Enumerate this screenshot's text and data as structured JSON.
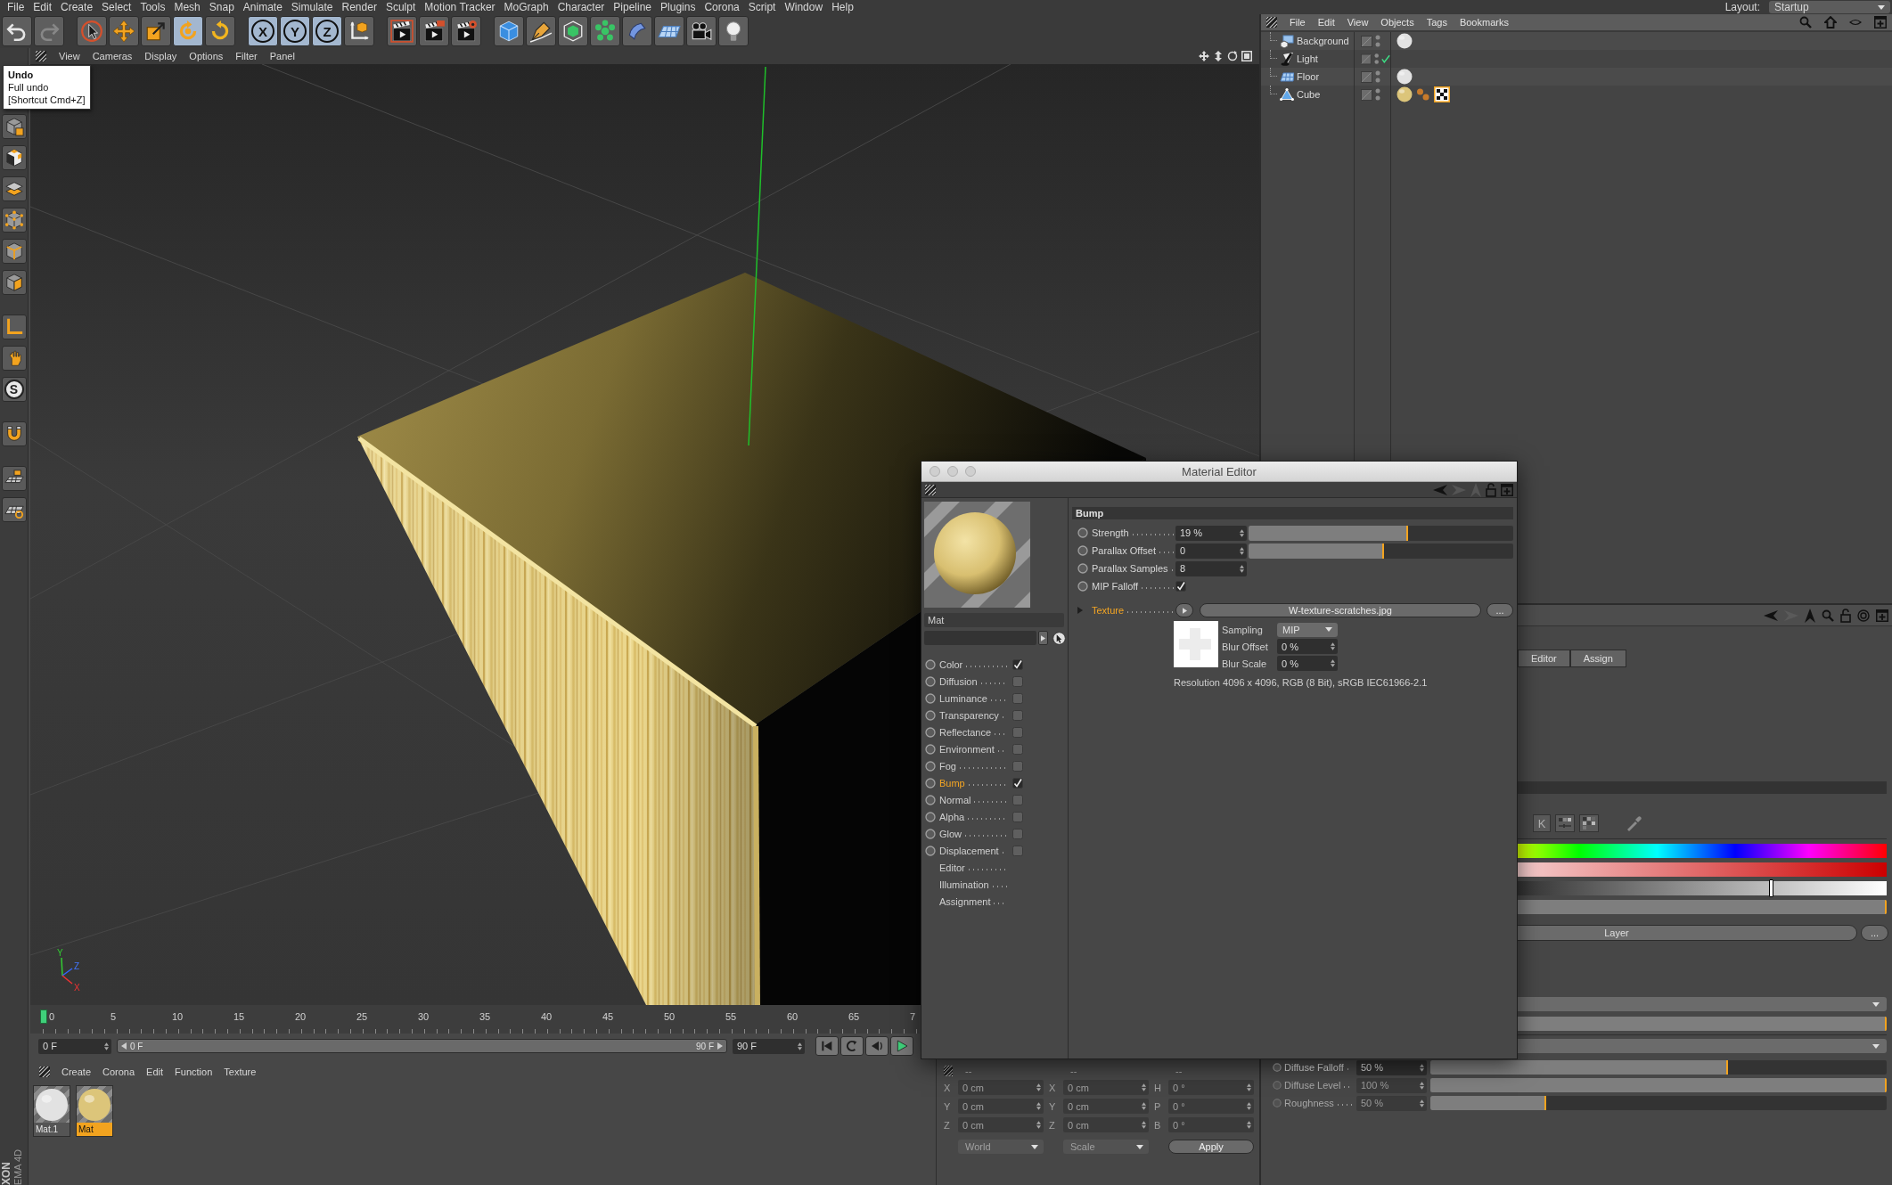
{
  "menubar": {
    "items": [
      "File",
      "Edit",
      "Create",
      "Select",
      "Tools",
      "Mesh",
      "Snap",
      "Animate",
      "Simulate",
      "Render",
      "Sculpt",
      "Motion Tracker",
      "MoGraph",
      "Character",
      "Pipeline",
      "Plugins",
      "Corona",
      "Script",
      "Window",
      "Help"
    ],
    "layout_label": "Layout:",
    "layout_value": "Startup"
  },
  "toolbar": {
    "tools": [
      {
        "on": false,
        "disabled": false
      },
      {
        "on": false,
        "disabled": true
      },
      {
        "on": false,
        "disabled": false
      },
      {
        "on": false,
        "disabled": false
      },
      {
        "on": false,
        "disabled": false
      },
      {
        "on": true,
        "disabled": false
      },
      {
        "on": false,
        "disabled": false
      },
      {
        "label": "X",
        "on": true,
        "disabled": false
      },
      {
        "label": "Y",
        "on": true,
        "disabled": false
      },
      {
        "label": "Z",
        "on": true,
        "disabled": false
      },
      {
        "on": false,
        "disabled": false
      },
      {
        "on": false,
        "disabled": false
      },
      {
        "on": false,
        "disabled": false
      },
      {
        "on": false,
        "disabled": false
      },
      {
        "on": false,
        "disabled": false
      },
      {
        "on": false,
        "disabled": false
      },
      {
        "on": false,
        "disabled": false
      },
      {
        "on": false,
        "disabled": false
      },
      {
        "on": false,
        "disabled": false
      },
      {
        "on": false,
        "disabled": false
      },
      {
        "on": false,
        "disabled": false
      },
      {
        "on": false,
        "disabled": false
      }
    ]
  },
  "tooltip": {
    "title": "Undo",
    "lines": [
      "Full undo",
      "[Shortcut Cmd+Z]"
    ]
  },
  "tool_palette": {
    "snap_label": "S"
  },
  "logo": {
    "lines": [
      "XON",
      "EMA 4D"
    ]
  },
  "viewport": {
    "menu": [
      "View",
      "Cameras",
      "Display",
      "Options",
      "Filter",
      "Panel"
    ],
    "axis_labels": [
      "Y",
      "Z",
      "X"
    ]
  },
  "timeline": {
    "ticks": [
      "0",
      "5",
      "10",
      "15",
      "20",
      "25",
      "30",
      "35",
      "40",
      "45",
      "50",
      "55",
      "60",
      "65",
      "7"
    ],
    "playhead": {
      "level": 0
    },
    "start_field": "0 F",
    "range_start": "0 F",
    "range_end": "90 F",
    "end_field": "90 F"
  },
  "material_manager": {
    "menu": [
      "Create",
      "Corona",
      "Edit",
      "Function",
      "Texture"
    ],
    "materials": [
      {
        "name": "Mat.1",
        "color": "#e2e2e2",
        "selected": false
      },
      {
        "name": "Mat",
        "color": "#dcc57a",
        "selected": true
      }
    ]
  },
  "coordinates": {
    "disabled": true,
    "headers": [
      "--",
      "--",
      "--"
    ],
    "rows": [
      [
        {
          "axis": "X",
          "value": "0 cm"
        },
        {
          "axis": "X",
          "value": "0 cm"
        },
        {
          "axis": "H",
          "value": "0 °"
        }
      ],
      [
        {
          "axis": "Y",
          "value": "0 cm"
        },
        {
          "axis": "Y",
          "value": "0 cm"
        },
        {
          "axis": "P",
          "value": "0 °"
        }
      ],
      [
        {
          "axis": "Z",
          "value": "0 cm"
        },
        {
          "axis": "Z",
          "value": "0 cm"
        },
        {
          "axis": "B",
          "value": "0 °"
        }
      ]
    ],
    "dropdowns": [
      "World",
      "Scale"
    ],
    "apply": "Apply"
  },
  "object_manager": {
    "menu": [
      "File",
      "Edit",
      "View",
      "Objects",
      "Tags",
      "Bookmarks"
    ],
    "objects": [
      {
        "name": "Background",
        "kind": "background",
        "enabled": false,
        "tags": [
          {
            "kind": "material",
            "color": "#e2e2e2",
            "selected": false
          }
        ]
      },
      {
        "name": "Light",
        "kind": "light",
        "enabled": true
      },
      {
        "name": "Floor",
        "kind": "floor",
        "enabled": false,
        "tags": [
          {
            "kind": "material",
            "color": "#e2e2e2",
            "selected": false
          }
        ]
      },
      {
        "name": "Cube",
        "kind": "polygon",
        "enabled": false,
        "tags": [
          {
            "kind": "material",
            "color": "#dcc57a",
            "selected": false
          },
          {
            "kind": "phong",
            "selected": false
          },
          {
            "kind": "uvw",
            "selected": true
          }
        ]
      }
    ]
  },
  "attribute_manager": {
    "tabs": [
      {
        "label": "Editor",
        "selected": false
      },
      {
        "label": "Assign",
        "selected": false
      }
    ],
    "kelvin_label": "K",
    "brightness": {
      "level": 0.75
    },
    "color_slider": {
      "level": 1
    },
    "layer_button": "Layer",
    "browse_button": "...",
    "controls": [
      {
        "kind": "dropdown"
      },
      {
        "kind": "slider",
        "level": 1
      },
      {
        "kind": "dropdown"
      }
    ],
    "params": [
      {
        "label": "Diffuse Falloff",
        "value": "50 %",
        "level": 0.65,
        "disabled": false
      },
      {
        "label": "Diffuse Level",
        "value": "100 %",
        "level": 1,
        "disabled": true
      },
      {
        "label": "Roughness",
        "value": "50 %",
        "level": 0.25,
        "disabled": true
      }
    ]
  },
  "material_editor": {
    "title": "Material Editor",
    "name": "Mat",
    "channels": [
      {
        "label": "Color",
        "checked": true,
        "selected": false
      },
      {
        "label": "Diffusion",
        "checked": false,
        "selected": false
      },
      {
        "label": "Luminance",
        "checked": false,
        "selected": false
      },
      {
        "label": "Transparency",
        "checked": false,
        "selected": false
      },
      {
        "label": "Reflectance",
        "checked": false,
        "selected": false
      },
      {
        "label": "Environment",
        "checked": false,
        "selected": false
      },
      {
        "label": "Fog",
        "checked": false,
        "selected": false
      },
      {
        "label": "Bump",
        "checked": true,
        "selected": true
      },
      {
        "label": "Normal",
        "checked": false,
        "selected": false
      },
      {
        "label": "Alpha",
        "checked": false,
        "selected": false
      },
      {
        "label": "Glow",
        "checked": false,
        "selected": false
      },
      {
        "label": "Displacement",
        "checked": false,
        "selected": false
      }
    ],
    "pages": [
      {
        "label": "Editor",
        "selected": false
      },
      {
        "label": "Illumination",
        "selected": false
      },
      {
        "label": "Assignment",
        "selected": false
      }
    ],
    "bump": {
      "title": "Bump",
      "params": [
        {
          "kind": "slider",
          "label": "Strength",
          "value": "19 %",
          "level": 0.6
        },
        {
          "kind": "slider",
          "label": "Parallax Offset",
          "value": "0",
          "level": 0.507
        },
        {
          "kind": "number",
          "label": "Parallax Samples",
          "value": "8"
        },
        {
          "kind": "checkbox",
          "label": "MIP Falloff",
          "checked": true
        }
      ],
      "texture": {
        "label": "Texture",
        "highlighted": true,
        "file": "W-texture-scratches.jpg",
        "browse": "...",
        "options": [
          {
            "kind": "dropdown",
            "label": "Sampling",
            "value": "MIP"
          },
          {
            "kind": "number",
            "label": "Blur Offset",
            "value": "0 %"
          },
          {
            "kind": "number",
            "label": "Blur Scale",
            "value": "0 %"
          }
        ],
        "info": "Resolution 4096 x 4096, RGB (8 Bit), sRGB IEC61966-2.1"
      }
    }
  }
}
